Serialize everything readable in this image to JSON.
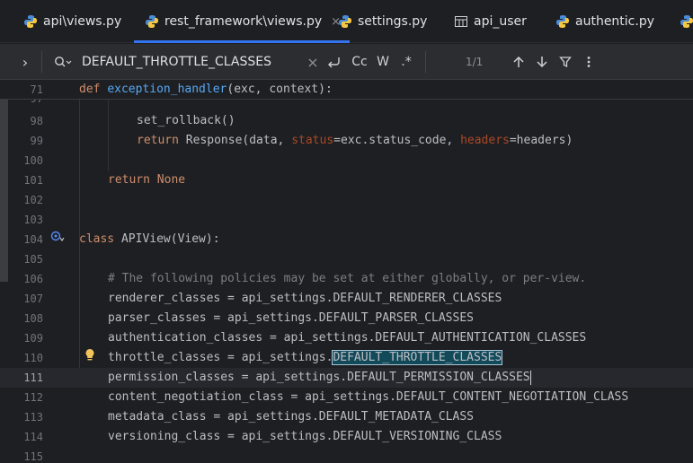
{
  "tabs": [
    {
      "label": "api\\views.py",
      "icon": "python-icon",
      "active": false
    },
    {
      "label": "rest_framework\\views.py",
      "icon": "python-icon",
      "active": true,
      "close": "×"
    },
    {
      "label": "settings.py",
      "icon": "python-icon",
      "active": false
    },
    {
      "label": "api_user",
      "icon": "table-icon",
      "active": false
    },
    {
      "label": "authentic.py",
      "icon": "python-icon",
      "active": false
    }
  ],
  "search": {
    "expand": "›",
    "options_icon": "Q⌄",
    "query": "DEFAULT_THROTTLE_CLASSES",
    "clear": "×",
    "match_case": "Cc",
    "whole_words": "W",
    "regex": ".*",
    "counter": "1/1"
  },
  "sticky_line": {
    "number": "71",
    "kw": "def",
    "fn": "exception_handler",
    "rest": "(exc, context):"
  },
  "lines": {
    "l97": "97",
    "l98": {
      "number": "98",
      "code": "set_rollback()"
    },
    "l99": {
      "number": "99",
      "kw": "return",
      "pre": " Response(data, ",
      "p1": "status",
      "mid": "=exc.status_code, ",
      "p2": "headers",
      "post": "=headers)"
    },
    "l100": "100",
    "l101": {
      "number": "101",
      "kw": "return",
      "kw2": "None"
    },
    "l102": "102",
    "l103": "103",
    "l104": {
      "number": "104",
      "kw": "class",
      "rest": " APIView(View):"
    },
    "l105": "105",
    "l106": {
      "number": "106",
      "comment": "# The following policies may be set at either globally, or per-view."
    },
    "l107": {
      "number": "107",
      "code": "renderer_classes = api_settings.DEFAULT_RENDERER_CLASSES"
    },
    "l108": {
      "number": "108",
      "code": "parser_classes = api_settings.DEFAULT_PARSER_CLASSES"
    },
    "l109": {
      "number": "109",
      "code": "authentication_classes = api_settings.DEFAULT_AUTHENTICATION_CLASSES"
    },
    "l110": {
      "number": "110",
      "pre": "throttle_classes = api_settings.",
      "match": "DEFAULT_THROTTLE_CLASSES"
    },
    "l111": {
      "number": "111",
      "code": "permission_classes = api_settings.DEFAULT_PERMISSION_CLASSES"
    },
    "l112": {
      "number": "112",
      "code": "content_negotiation_class = api_settings.DEFAULT_CONTENT_NEGOTIATION_CLASS"
    },
    "l113": {
      "number": "113",
      "code": "metadata_class = api_settings.DEFAULT_METADATA_CLASS"
    },
    "l114": {
      "number": "114",
      "code": "versioning_class = api_settings.DEFAULT_VERSIONING_CLASS"
    },
    "l115": "115"
  },
  "colors": {
    "accent": "#3574f0",
    "keyword": "#cf8e6d",
    "function": "#56a8f5",
    "param": "#aa4926",
    "comment": "#7a7e85"
  }
}
